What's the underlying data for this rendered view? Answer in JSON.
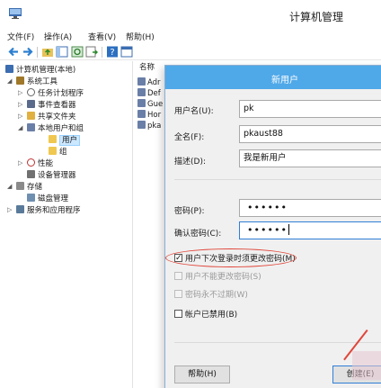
{
  "window": {
    "title": "计算机管理",
    "icon": "computer-management-icon"
  },
  "menu": [
    "文件(F)",
    "操作(A)",
    "查看(V)",
    "帮助(H)"
  ],
  "toolbar": {
    "buttons": [
      "back-icon",
      "forward-icon",
      "up-folder-icon",
      "show-hide-tree-icon",
      "refresh-icon",
      "export-list-icon",
      "help-icon",
      "properties-icon"
    ]
  },
  "tree": {
    "root": "计算机管理(本地)",
    "system_tools": "系统工具",
    "task_scheduler": "任务计划程序",
    "event_viewer": "事件查看器",
    "shared_folders": "共享文件夹",
    "local_users_groups": "本地用户和组",
    "users": "用户",
    "groups": "组",
    "performance": "性能",
    "device_manager": "设备管理器",
    "storage": "存储",
    "disk_management": "磁盘管理",
    "services_apps": "服务和应用程序"
  },
  "list": {
    "header": "名称",
    "items": [
      "Adr",
      "Def",
      "Gue",
      "Hor",
      "pka"
    ]
  },
  "dialog": {
    "title": "新用户",
    "username_label": "用户名(U):",
    "username_value": "pk",
    "fullname_label": "全名(F):",
    "fullname_value": "pkaust88",
    "description_label": "描述(D):",
    "description_value": "我是新用户",
    "password_label": "密码(P):",
    "password_value": "••••••",
    "confirm_label": "确认密码(C):",
    "confirm_value": "••••••",
    "must_change": "用户下次登录时须更改密码(M)",
    "cannot_change": "用户不能更改密码(S)",
    "never_expires": "密码永不过期(W)",
    "disabled": "帐户已禁用(B)",
    "help_button": "帮助(H)",
    "create_button": "创建(E)"
  },
  "colors": {
    "dialog_title_bar": "#4fa8e8",
    "highlight": "#e0463a",
    "selection": "#cce8ff"
  }
}
